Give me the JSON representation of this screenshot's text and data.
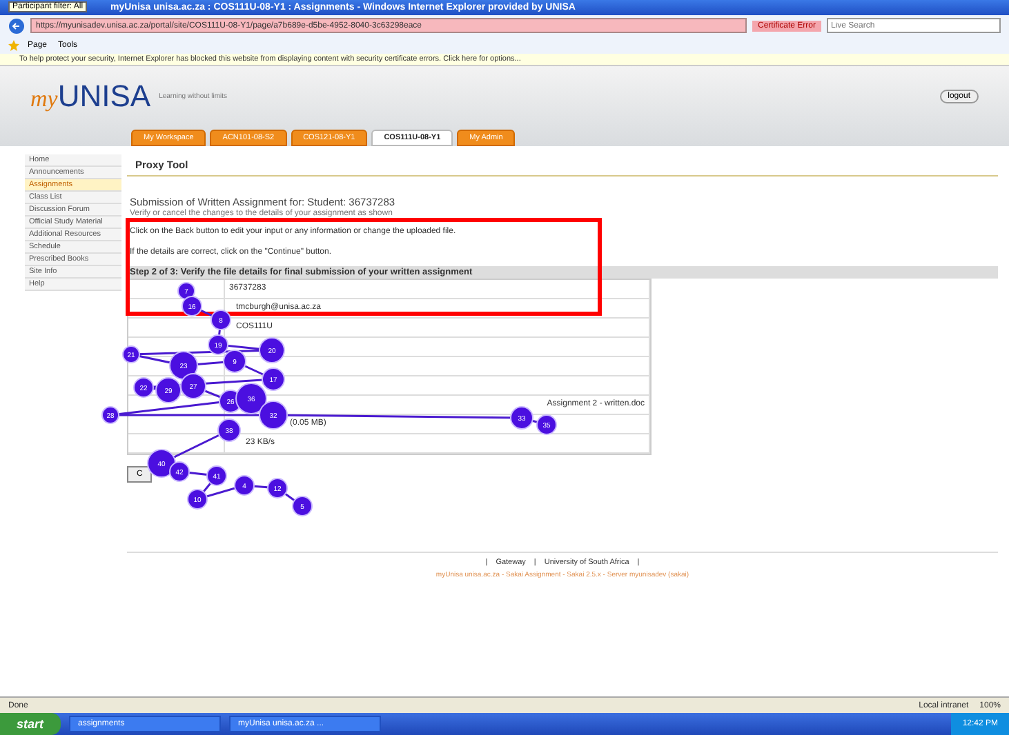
{
  "window": {
    "title": "myUnisa unisa.ac.za : COS111U-08-Y1 : Assignments - Windows Internet Explorer provided by UNISA",
    "tooltip": "Participant filter: All"
  },
  "address_bar": {
    "url": "https://myunisadev.unisa.ac.za/portal/site/COS111U-08-Y1/page/a7b689e-d5be-4952-8040-3c63298eace",
    "certificate": "Certificate Error",
    "search_placeholder": "Live Search"
  },
  "command_bar": [
    "Page",
    "Tools"
  ],
  "info_bar": "To help protect your security, Internet Explorer has blocked this website from displaying content with security certificate errors. Click here for options...",
  "site": {
    "logo_prefix": "my",
    "logo": "UNISA",
    "tagline": "Learning without limits",
    "logout": "logout"
  },
  "tabs": [
    {
      "label": "My Workspace",
      "selected": false
    },
    {
      "label": "ACN101-08-S2",
      "selected": false
    },
    {
      "label": "COS121-08-Y1",
      "selected": false
    },
    {
      "label": "COS111U-08-Y1",
      "selected": true
    },
    {
      "label": "My Admin",
      "selected": false
    }
  ],
  "sidebar": {
    "items": [
      {
        "label": "Home",
        "selected": false
      },
      {
        "label": "Announcements",
        "selected": false
      },
      {
        "label": "Assignments",
        "selected": true
      },
      {
        "label": "Class List",
        "selected": false
      },
      {
        "label": "Discussion Forum",
        "selected": false
      },
      {
        "label": "Official Study Material",
        "selected": false
      },
      {
        "label": "Additional Resources",
        "selected": false
      },
      {
        "label": "Schedule",
        "selected": false
      },
      {
        "label": "Prescribed Books",
        "selected": false
      },
      {
        "label": "Site Info",
        "selected": false
      },
      {
        "label": "Help",
        "selected": false
      }
    ]
  },
  "tool": {
    "title": "Proxy Tool",
    "heading": "Submission of Written Assignment for: Student: 36737283",
    "subheading": "Verify or cancel the changes to the details of your assignment as shown",
    "instructions": [
      "Click on the Back button to edit your input or any information or change the uploaded file.",
      "If the details are correct, click on the \"Continue\" button."
    ],
    "step": "Step 2 of 3: Verify the file details for final submission of your written assignment",
    "rows": [
      {
        "value": "36737283"
      },
      {
        "value": "tmcburgh@unisa.ac.za"
      },
      {
        "value": "COS111U"
      },
      {},
      {},
      {},
      {
        "value": "Assignment 2 - written.doc"
      },
      {
        "value": "(0.05 MB)"
      },
      {
        "value": "23 KB/s"
      }
    ],
    "button": "C"
  },
  "footer": {
    "links": [
      "Gateway",
      "University of South Africa"
    ],
    "separator": "|",
    "credits": "myUnisa unisa.ac.za - Sakai Assignment - Sakai 2.5.x - Server myunisadev (sakai)"
  },
  "gaze_plot": {
    "fixations": [
      {
        "label": "7"
      },
      {
        "label": "16"
      },
      {
        "label": "8"
      },
      {
        "label": "19"
      },
      {
        "label": "20"
      },
      {
        "label": "21"
      },
      {
        "label": "23"
      },
      {
        "label": "9"
      },
      {
        "label": "17"
      },
      {
        "label": "22"
      },
      {
        "label": "29"
      },
      {
        "label": "27"
      },
      {
        "label": "26"
      },
      {
        "label": "36"
      },
      {
        "label": "28"
      },
      {
        "label": "32"
      },
      {
        "label": "33"
      },
      {
        "label": "35"
      },
      {
        "label": "38"
      },
      {
        "label": "40"
      },
      {
        "label": "42"
      },
      {
        "label": "41"
      },
      {
        "label": "10"
      },
      {
        "label": "4"
      },
      {
        "label": "12"
      },
      {
        "label": "5"
      }
    ]
  },
  "status_bar": {
    "status": "Done",
    "zone": "Local intranet",
    "zoom": "100%"
  },
  "taskbar": {
    "start": "start",
    "items": [
      "assignments",
      "myUnisa unisa.ac.za ..."
    ],
    "clock": "12:42 PM"
  }
}
